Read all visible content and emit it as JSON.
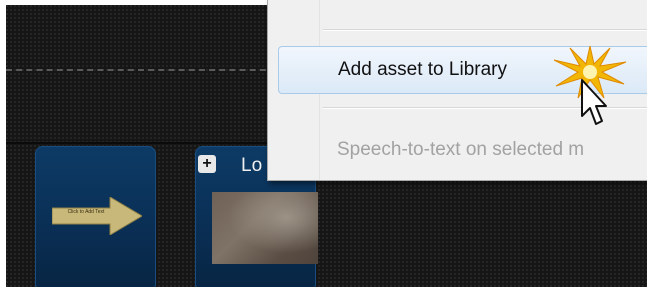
{
  "timeline": {
    "tiles": [
      {
        "name": "title-clip",
        "caption": "Click to Add Text"
      },
      {
        "name": "video-clip",
        "add_icon": "plus-icon",
        "title": "Lo"
      }
    ]
  },
  "context_menu": {
    "items": [
      {
        "label": "Add asset to Library",
        "state": "hover"
      },
      {
        "label": "Speech-to-text on selected m",
        "state": "disabled"
      }
    ]
  },
  "icons": {
    "add": "+",
    "sparkle": "click-sparkle-icon",
    "cursor": "mouse-pointer-icon"
  },
  "colors": {
    "tile_blue": "#0d3b66",
    "menu_bg": "#f0f0f0",
    "hover_border": "#a8cbea",
    "disabled_text": "#a2a2a2",
    "sparkle": "#f2b705"
  }
}
